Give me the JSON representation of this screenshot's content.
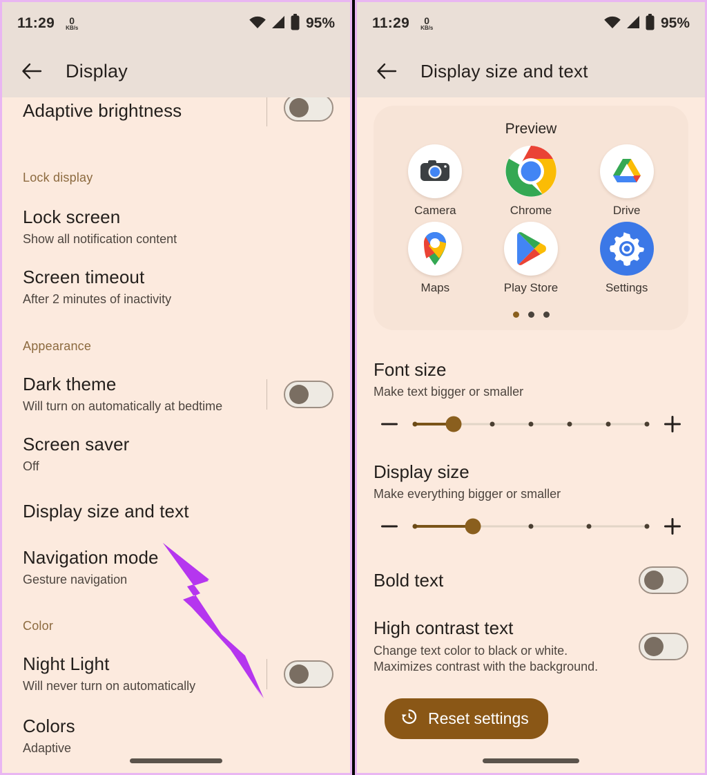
{
  "theme": {
    "page_bg": "#fceade",
    "bar_bg": "#eadfd7",
    "card_bg": "#f7e4d7",
    "accent": "#8a5f1e",
    "section_label": "#8c6a3f",
    "border": "#e9b6f2",
    "arrow": "#b536ef"
  },
  "status_bar": {
    "time": "11:29",
    "net_speed_value": "0",
    "net_speed_unit": "KB/s",
    "wifi_icon": "wifi-icon",
    "signal_icon": "cellular-signal-icon",
    "battery_icon": "battery-full-icon",
    "battery_percent": "95%"
  },
  "left_panel": {
    "back_icon": "arrow-left-icon",
    "title": "Display",
    "items": [
      {
        "kind": "switch_row",
        "title": "Adaptive brightness",
        "sub": "",
        "toggle": "off",
        "clipped_top": true
      },
      {
        "kind": "section",
        "title": "Lock display"
      },
      {
        "kind": "row",
        "title": "Lock screen",
        "sub": "Show all notification content"
      },
      {
        "kind": "row",
        "title": "Screen timeout",
        "sub": "After 2 minutes of inactivity"
      },
      {
        "kind": "section",
        "title": "Appearance"
      },
      {
        "kind": "switch_row",
        "title": "Dark theme",
        "sub": "Will turn on automatically at bedtime",
        "toggle": "off"
      },
      {
        "kind": "row",
        "title": "Screen saver",
        "sub": "Off"
      },
      {
        "kind": "row",
        "title": "Display size and text",
        "sub": ""
      },
      {
        "kind": "row",
        "title": "Navigation mode",
        "sub": "Gesture navigation"
      },
      {
        "kind": "section",
        "title": "Color"
      },
      {
        "kind": "switch_row",
        "title": "Night Light",
        "sub": "Will never turn on automatically",
        "toggle": "off"
      },
      {
        "kind": "row",
        "title": "Colors",
        "sub": "Adaptive",
        "clipped_bottom": true
      }
    ],
    "nav_pill": "home-gesture-pill"
  },
  "right_panel": {
    "back_icon": "arrow-left-icon",
    "title": "Display size and text",
    "preview": {
      "label": "Preview",
      "apps": [
        {
          "name": "Camera",
          "icon": "camera-app-icon"
        },
        {
          "name": "Chrome",
          "icon": "chrome-app-icon"
        },
        {
          "name": "Drive",
          "icon": "google-drive-app-icon"
        },
        {
          "name": "Maps",
          "icon": "google-maps-app-icon"
        },
        {
          "name": "Play Store",
          "icon": "play-store-app-icon"
        },
        {
          "name": "Settings",
          "icon": "settings-app-icon"
        }
      ],
      "page_dots": {
        "count": 3,
        "active_index": 0
      }
    },
    "font_size": {
      "title": "Font size",
      "sub": "Make text bigger or smaller",
      "decrease_icon": "minus-icon",
      "increase_icon": "plus-icon",
      "steps": 7,
      "value_index": 1
    },
    "display_size": {
      "title": "Display size",
      "sub": "Make everything bigger or smaller",
      "decrease_icon": "minus-icon",
      "increase_icon": "plus-icon",
      "steps": 5,
      "value_index": 1
    },
    "bold_text": {
      "title": "Bold text",
      "sub": "",
      "toggle": "off"
    },
    "high_contrast_text": {
      "title": "High contrast text",
      "sub": "Change text color to black or white. Maximizes contrast with the background.",
      "toggle": "off"
    },
    "reset_button": {
      "label": "Reset settings",
      "icon": "history-restore-icon"
    },
    "nav_pill": "home-gesture-pill"
  },
  "annotation": {
    "arrow_icon": "purple-pointer-arrow",
    "points_at": "Display size and text"
  }
}
